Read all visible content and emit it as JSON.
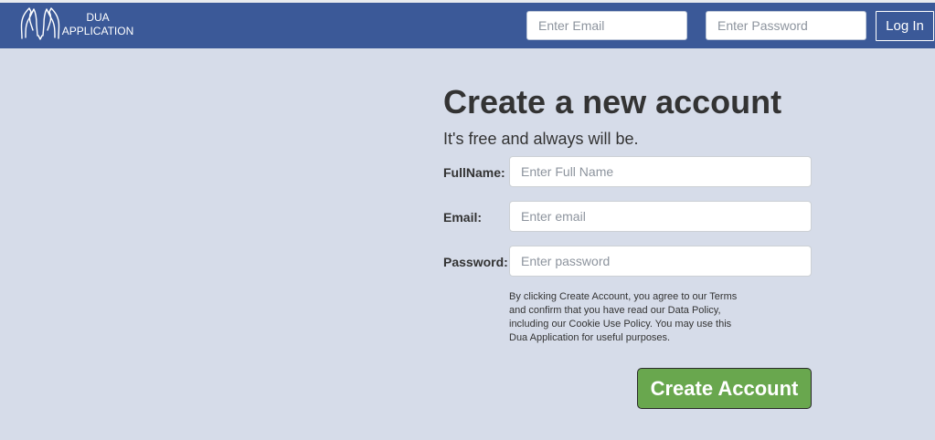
{
  "header": {
    "logo_icon": "praying-hands-icon",
    "brand_line1": "DUA",
    "brand_line2": "APPLICATION",
    "email_placeholder": "Enter Email",
    "password_placeholder": "Enter Password",
    "login_label": "Log In",
    "bg_color": "#3b5998"
  },
  "signup": {
    "title": "Create a new account",
    "subtitle": "It's free and always will be.",
    "fullname_label": "FullName:",
    "fullname_placeholder": "Enter Full Name",
    "email_label": "Email:",
    "email_placeholder": "Enter email",
    "password_label": "Password:",
    "password_placeholder": "Enter password",
    "terms_text": "By clicking Create Account, you agree to our Terms and confirm that you have read our Data Policy, including our Cookie Use Policy. You may use this Dua Application for useful purposes.",
    "create_label": "Create Account",
    "button_color": "#69a74e"
  },
  "page_bg": "#d6dce9"
}
